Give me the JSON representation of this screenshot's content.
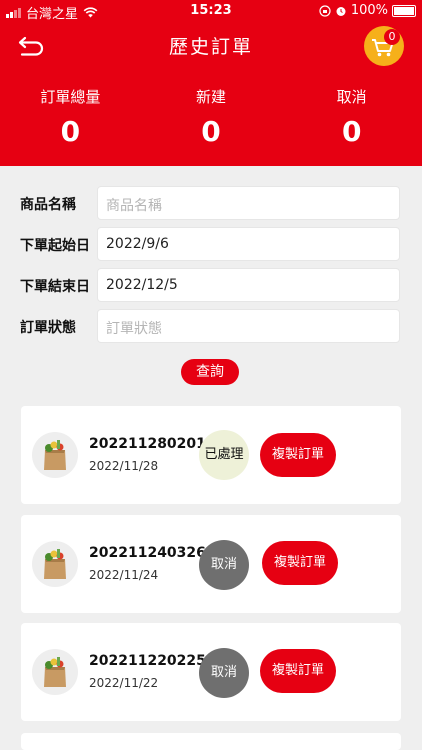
{
  "status_bar": {
    "carrier": "台灣之星",
    "time": "15:23",
    "battery": "100%"
  },
  "header": {
    "title": "歷史訂單",
    "cart_count": "0"
  },
  "stats": [
    {
      "label": "訂單總量",
      "value": "0"
    },
    {
      "label": "新建",
      "value": "0"
    },
    {
      "label": "取消",
      "value": "0"
    }
  ],
  "form": {
    "product_name": {
      "label": "商品名稱",
      "value": "",
      "placeholder": "商品名稱"
    },
    "start_date": {
      "label": "下單起始日",
      "value": "2022/9/6",
      "placeholder": ""
    },
    "end_date": {
      "label": "下單結束日",
      "value": "2022/12/5",
      "placeholder": ""
    },
    "status": {
      "label": "訂單狀態",
      "value": "",
      "placeholder": "訂單狀態"
    },
    "search_label": "查詢"
  },
  "orders": [
    {
      "number": "202211280201",
      "date": "2022/11/28",
      "status": "已處理",
      "action": "複製訂單"
    },
    {
      "number": "202211240326",
      "date": "2022/11/24",
      "status": "取消",
      "action": "複製訂單"
    },
    {
      "number": "202211220225",
      "date": "2022/11/22",
      "status": "取消",
      "action": "複製訂單"
    }
  ],
  "colors": {
    "brand_red": "#e60012",
    "cart_yellow": "#f6b01a",
    "processed_bg": "#eef1d8",
    "cancel_bg": "#6f6f6f"
  },
  "icons": [
    "back-icon",
    "cart-icon",
    "grocery-bag-icon",
    "wifi-icon",
    "signal-icon",
    "battery-icon",
    "lock-rotation-icon",
    "alarm-icon"
  ]
}
